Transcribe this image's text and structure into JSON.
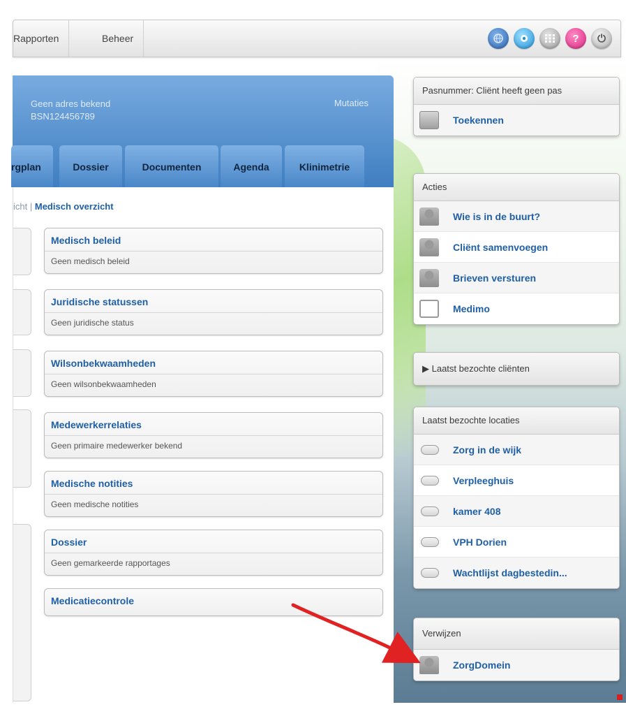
{
  "topnav": {
    "menu": [
      "Rapporten",
      "Beheer"
    ],
    "tools": [
      {
        "icon": "globe-icon",
        "color": "#3c6fb8"
      },
      {
        "icon": "settings-circle-icon",
        "color": "#2b9be0"
      },
      {
        "icon": "keypad-icon",
        "color": "#9a9a9a"
      },
      {
        "icon": "help-icon",
        "color": "#e03a8c",
        "glyph": "?"
      },
      {
        "icon": "power-icon",
        "color": "#b9b9b9",
        "glyph": "⏻"
      }
    ]
  },
  "client": {
    "address": "Geen adres bekend",
    "bsn": "BSN124456789",
    "mutaties": "Mutaties"
  },
  "tabs": [
    "rgplan",
    "Dossier",
    "Documenten",
    "Agenda",
    "Klinimetrie"
  ],
  "breadcrumb": {
    "prev": "icht",
    "separator": "|",
    "current": "Medisch overzicht"
  },
  "cards": [
    {
      "title": "Medisch beleid",
      "desc": "Geen medisch beleid"
    },
    {
      "title": "Juridische statussen",
      "desc": "Geen juridische status"
    },
    {
      "title": "Wilsonbekwaamheden",
      "desc": "Geen wilsonbekwaamheden"
    },
    {
      "title": "Medewerkerrelaties",
      "desc": "Geen primaire medewerker bekend"
    },
    {
      "title": "Medische notities",
      "desc": "Geen medische notities"
    },
    {
      "title": "Dossier",
      "desc": "Geen gemarkeerde rapportages"
    },
    {
      "title": "Medicatiecontrole",
      "desc": ""
    }
  ],
  "pas_panel": {
    "header": "Pasnummer: Cliënt heeft geen pas",
    "items": [
      {
        "label": "Toekennen",
        "icon": "card-icon"
      }
    ]
  },
  "acties_panel": {
    "header": "Acties",
    "items": [
      {
        "label": "Wie is in de buurt?",
        "icon": "person-icon"
      },
      {
        "label": "Cliënt samenvoegen",
        "icon": "person-icon"
      },
      {
        "label": "Brieven versturen",
        "icon": "person-icon"
      },
      {
        "label": "Medimo",
        "icon": "plus-icon"
      }
    ]
  },
  "recent_clients_panel": {
    "header": "▶ Laatst bezochte cliënten"
  },
  "locaties_panel": {
    "header": "Laatst bezochte locaties",
    "items": [
      {
        "label": "Zorg in de wijk",
        "icon": "location-icon"
      },
      {
        "label": "Verpleeghuis",
        "icon": "location-icon"
      },
      {
        "label": "kamer 408",
        "icon": "location-icon"
      },
      {
        "label": "VPH Dorien",
        "icon": "location-icon"
      },
      {
        "label": "Wachtlijst dagbestedin...",
        "icon": "location-icon"
      }
    ]
  },
  "verwijzen_panel": {
    "header": "Verwijzen",
    "items": [
      {
        "label": "ZorgDomein",
        "icon": "person-icon"
      }
    ]
  },
  "annotation": {
    "color": "#e02222"
  }
}
